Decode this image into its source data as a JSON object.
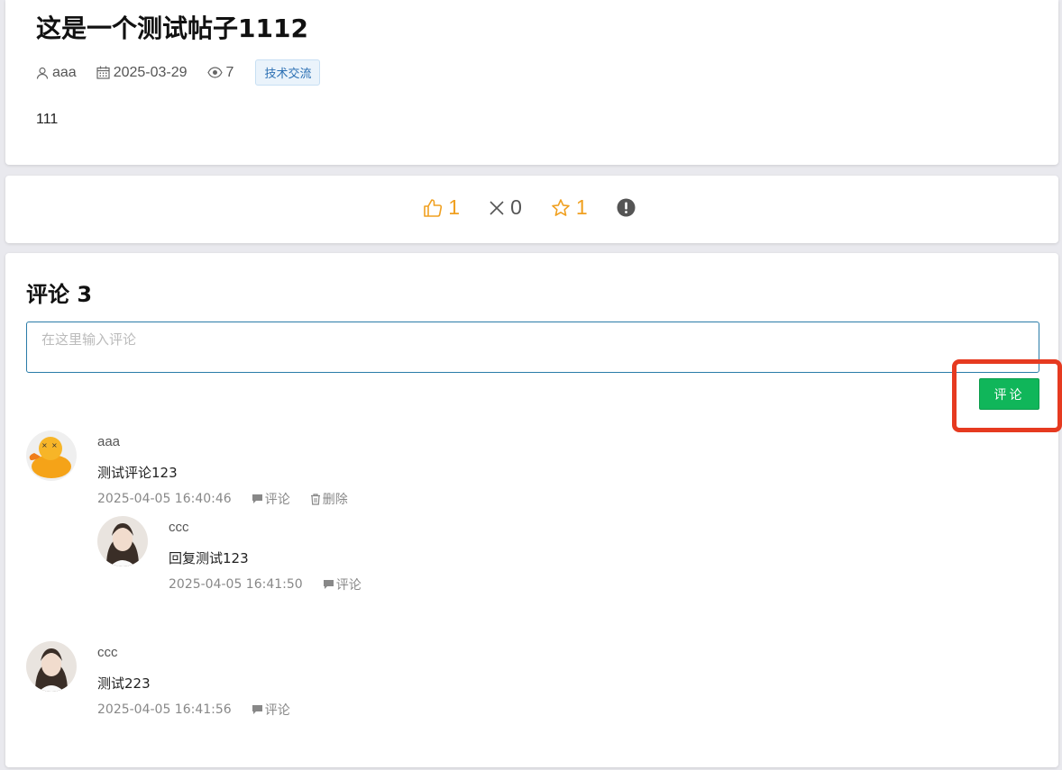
{
  "post": {
    "title": "这是一个测试帖子1112",
    "author": "aaa",
    "date": "2025-03-29",
    "views": "7",
    "tag": "技术交流",
    "content": "111"
  },
  "actions": {
    "likes": "1",
    "dislikes": "0",
    "favorites": "1"
  },
  "comments_section": {
    "title": "评论 3",
    "input_placeholder": "在这里输入评论",
    "submit_label": "评论",
    "reply_label": "评论",
    "delete_label": "删除",
    "items": [
      {
        "author": "aaa",
        "text": "测试评论123",
        "time": "2025-04-05 16:40:46",
        "replies": [
          {
            "author": "ccc",
            "text": "回复测试123",
            "time": "2025-04-05 16:41:50"
          }
        ]
      },
      {
        "author": "ccc",
        "text": "测试223",
        "time": "2025-04-05 16:41:56",
        "replies": []
      }
    ]
  },
  "colors": {
    "accent_green": "#10b65a",
    "like_orange": "#f0a020",
    "highlight_red": "#e63a20",
    "tag_blue": "#2b6fb3"
  }
}
